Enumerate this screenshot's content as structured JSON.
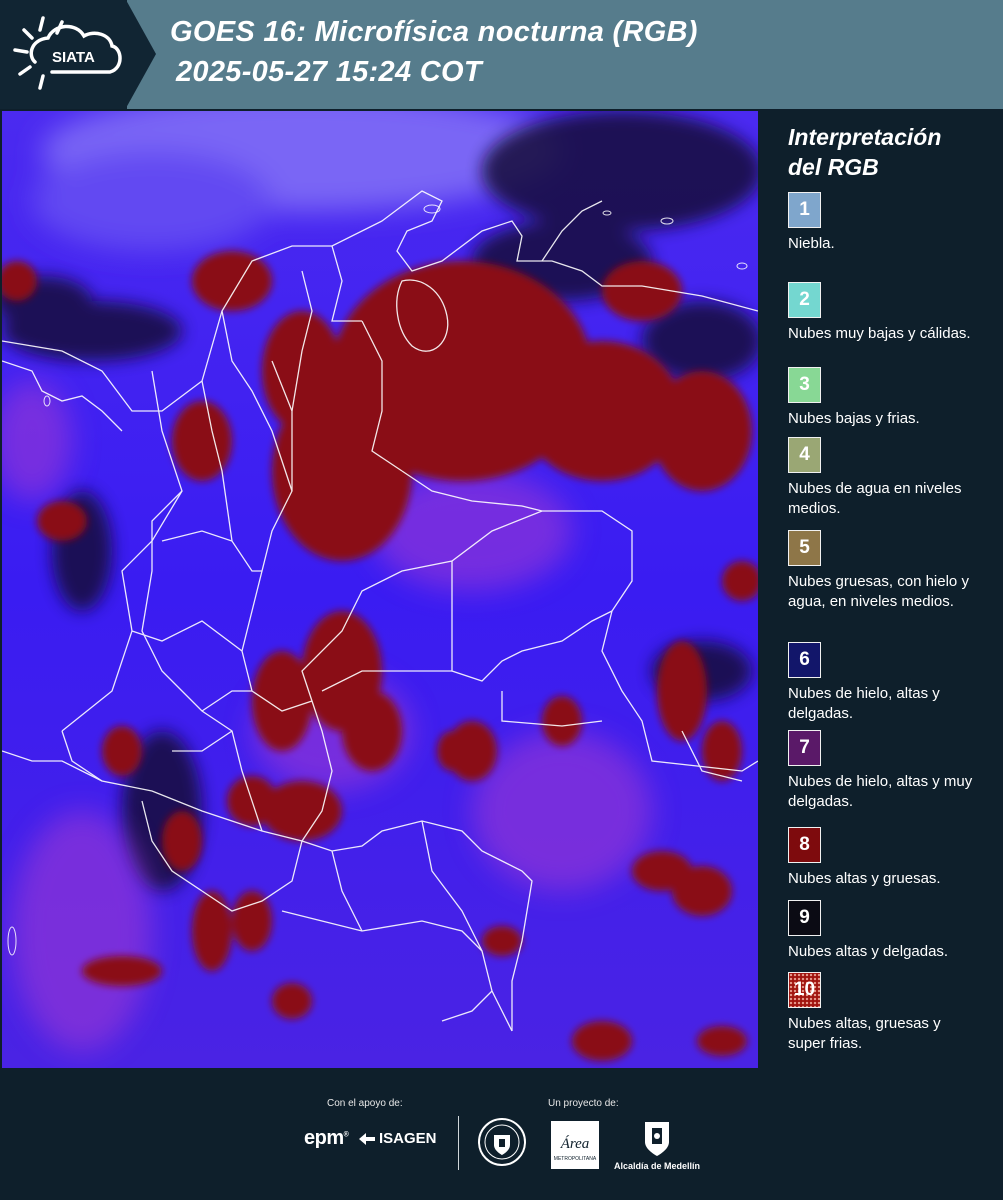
{
  "header": {
    "logo_text": "SIATA",
    "title_line1": "GOES 16: Microfísica nocturna (RGB)",
    "title_line2": "2025-05-27 15:24 COT",
    "colors": {
      "header_bg": "#567c8c",
      "logo_bg": "#112533"
    }
  },
  "map": {
    "type": "satellite-rgb-composite",
    "colors": {
      "clear_sky": "#3a1cf2",
      "high_thick_clouds": "#8a0a12",
      "thin_clouds": "#1a0a3a",
      "borders": "#ffffff"
    }
  },
  "legend": {
    "title_line1": "Interpretación",
    "title_line2": "del RGB",
    "items": [
      {
        "number": "1",
        "color": "#7fa6cc",
        "text": "Niebla."
      },
      {
        "number": "2",
        "color": "#74d7d0",
        "text": "Nubes muy bajas y cálidas."
      },
      {
        "number": "3",
        "color": "#88d895",
        "text": "Nubes bajas y frias."
      },
      {
        "number": "4",
        "color": "#9aa774",
        "text": "Nubes de agua en niveles medios."
      },
      {
        "number": "5",
        "color": "#8e7648",
        "text": "Nubes gruesas, con hielo y agua, en niveles medios."
      },
      {
        "number": "6",
        "color": "#12166a",
        "text": "Nubes de hielo, altas y delgadas."
      },
      {
        "number": "7",
        "color": "#5a1968",
        "text": "Nubes de hielo, altas y muy delgadas."
      },
      {
        "number": "8",
        "color": "#7e0b0d",
        "text": "Nubes altas y gruesas."
      },
      {
        "number": "9",
        "color": "#0b0b14",
        "text": "Nubes altas y delgadas."
      },
      {
        "number": "10",
        "color": "#a0140e",
        "text": "Nubes altas, gruesas y super frias."
      }
    ]
  },
  "footer": {
    "support_label": "Con el apoyo de:",
    "project_label": "Un proyecto de:",
    "sponsor_1": "epm",
    "sponsor_2": "ISAGEN",
    "partner_area_logo": "Área",
    "partner_area_subtitle": "METROPOLITANA",
    "partner_alcaldia": "Alcaldía de Medellín"
  }
}
